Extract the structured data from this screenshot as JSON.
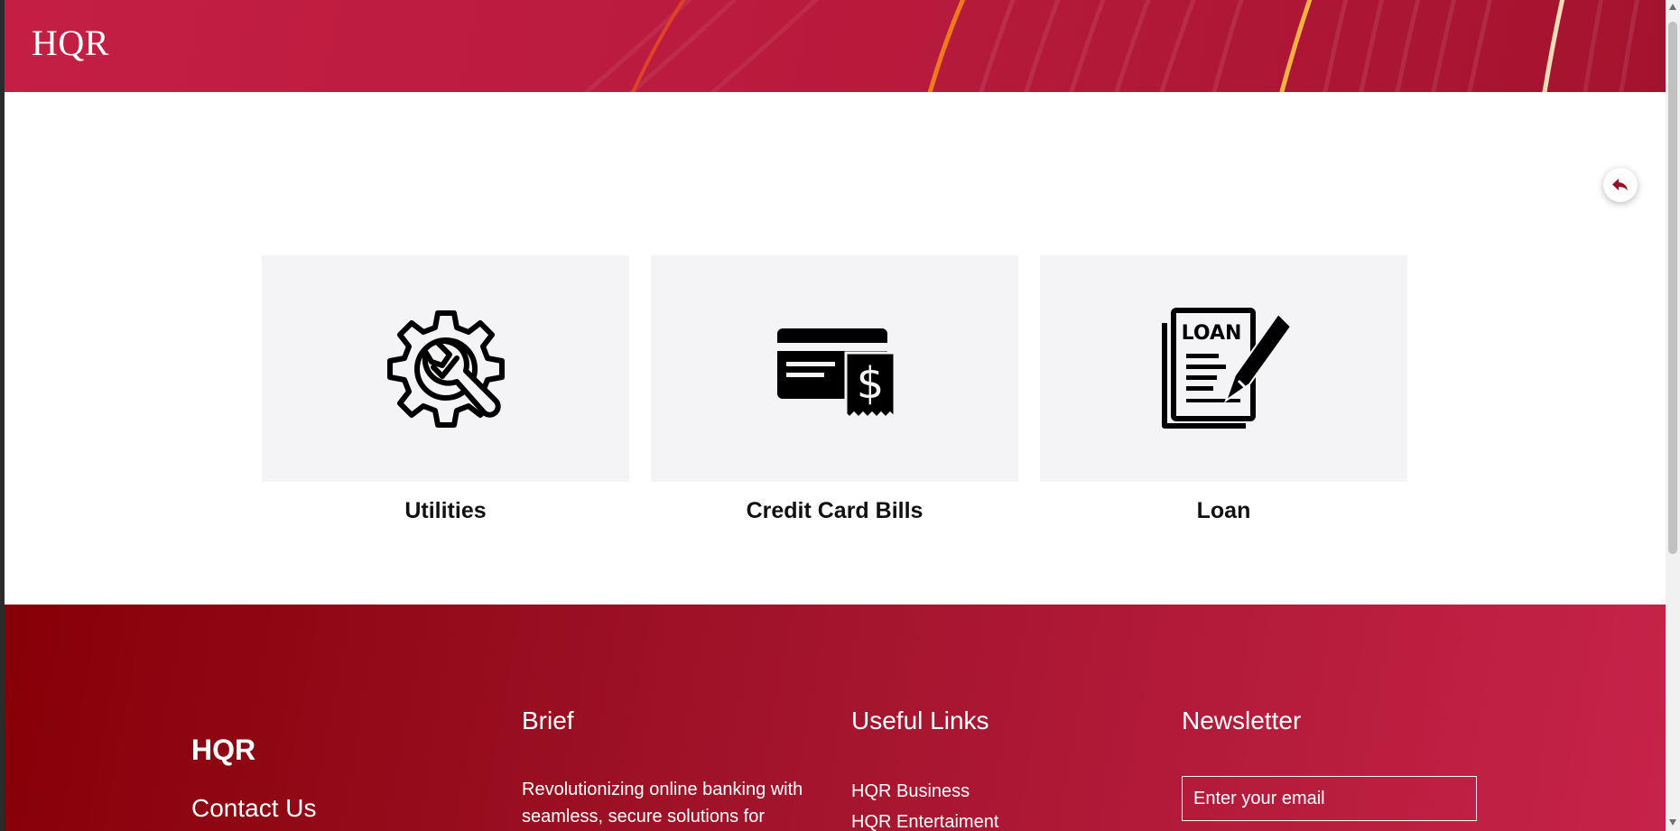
{
  "header": {
    "brand": "HQR"
  },
  "colors": {
    "brand_red": "#b71a3c",
    "footer_dark": "#860007",
    "footer_light": "#c7234a",
    "card_bg": "#f4f4f6"
  },
  "back_button": {
    "icon": "reply-arrow-icon"
  },
  "services": [
    {
      "label": "Utilities",
      "icon": "gear-wrench-icon"
    },
    {
      "label": "Credit Card Bills",
      "icon": "bill-dollar-icon"
    },
    {
      "label": "Loan",
      "icon": "loan-document-pen-icon",
      "icon_text": "LOAN"
    }
  ],
  "footer": {
    "brand": "HQR",
    "contact": "Contact Us",
    "brief": {
      "heading": "Brief",
      "text": "Revolutionizing online banking with seamless, secure solutions for"
    },
    "useful_links": {
      "heading": "Useful Links",
      "links": [
        "HQR Business",
        "HQR Entertaiment"
      ]
    },
    "newsletter": {
      "heading": "Newsletter",
      "placeholder": "Enter your email"
    }
  }
}
